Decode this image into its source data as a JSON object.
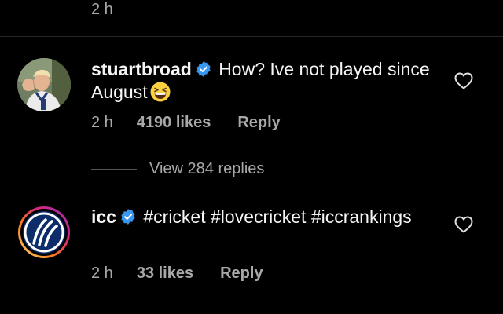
{
  "previous_comment": {
    "time": "2 h"
  },
  "comments": [
    {
      "username": "stuartbroad",
      "verified": true,
      "text": "How? Ive not played since August",
      "emoji": "grinning-squinting-face",
      "time": "2 h",
      "likes": "4190 likes",
      "reply_label": "Reply",
      "view_replies": "View 284 replies"
    },
    {
      "username": "icc",
      "verified": true,
      "text": "#cricket #lovecricket #iccrankings",
      "time": "2 h",
      "likes": "33 likes",
      "reply_label": "Reply"
    }
  ],
  "colors": {
    "background": "#000000",
    "text_primary": "#f5f5f5",
    "text_secondary": "#a8a8a8",
    "verified_blue": "#3897f0",
    "divider": "#262626"
  }
}
